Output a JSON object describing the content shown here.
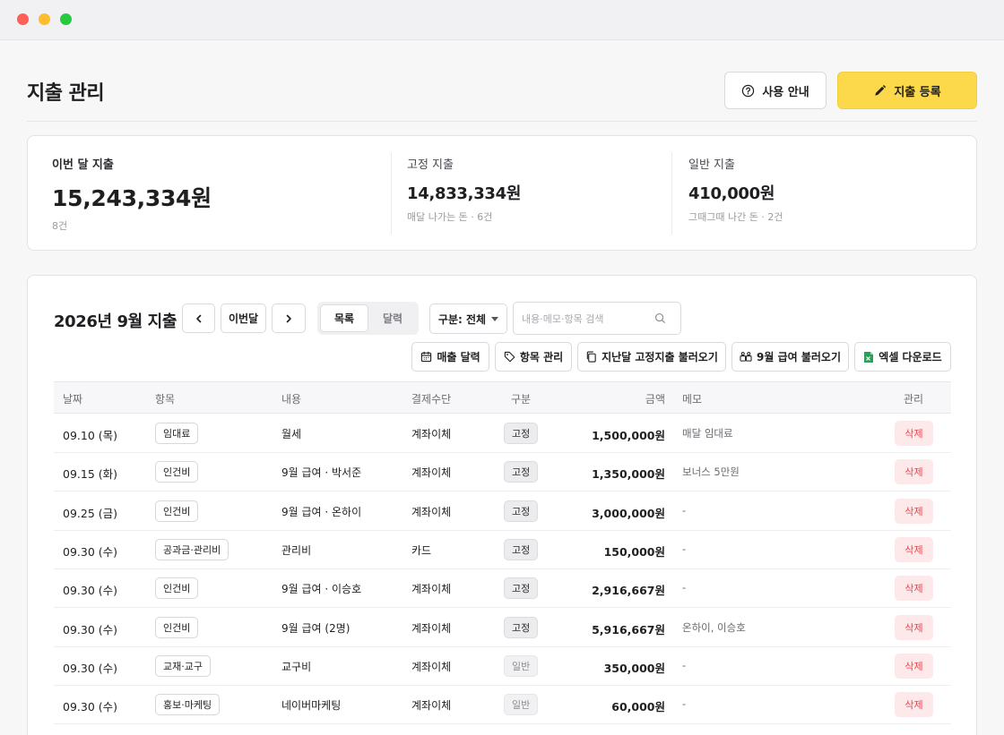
{
  "page": {
    "title": "지출 관리",
    "help_label": "사용 안내",
    "add_label": "지출 등록"
  },
  "summary": {
    "month": {
      "label": "이번 달 지출",
      "value": "15,243,334원",
      "sub": "8건"
    },
    "fixed": {
      "label": "고정 지출",
      "value": "14,833,334원",
      "sub": "매달 나가는 돈 · 6건"
    },
    "normal": {
      "label": "일반 지출",
      "value": "410,000원",
      "sub": "그때그때 나간 돈 · 2건"
    }
  },
  "toolbar": {
    "period_title": "2026년 9월 지출",
    "this_month": "이번달",
    "view_list": "목록",
    "view_calendar": "달력",
    "filter": "구분: 전체",
    "search_placeholder": "내용·메모·항목 검색",
    "sales_calendar": "매출 달력",
    "manage_items": "항목 관리",
    "load_fixed": "지난달 고정지출 불러오기",
    "load_salary": "9월 급여 불러오기",
    "excel": "엑셀 다운로드"
  },
  "table": {
    "columns": [
      "날짜",
      "항목",
      "내용",
      "결제수단",
      "구분",
      "금액",
      "메모",
      "관리"
    ],
    "delete_label": "삭제",
    "rows": [
      {
        "date": "09.10 (목)",
        "category": "임대료",
        "desc": "월세",
        "payment": "계좌이체",
        "type": "고정",
        "type_kind": "fixed",
        "amount": "1,500,000원",
        "memo": "매달 임대료"
      },
      {
        "date": "09.15 (화)",
        "category": "인건비",
        "desc": "9월 급여 · 박서준",
        "payment": "계좌이체",
        "type": "고정",
        "type_kind": "fixed",
        "amount": "1,350,000원",
        "memo": "보너스 5만원"
      },
      {
        "date": "09.25 (금)",
        "category": "인건비",
        "desc": "9월 급여 · 온하이",
        "payment": "계좌이체",
        "type": "고정",
        "type_kind": "fixed",
        "amount": "3,000,000원",
        "memo": "-"
      },
      {
        "date": "09.30 (수)",
        "category": "공과금·관리비",
        "desc": "관리비",
        "payment": "카드",
        "type": "고정",
        "type_kind": "fixed",
        "amount": "150,000원",
        "memo": "-"
      },
      {
        "date": "09.30 (수)",
        "category": "인건비",
        "desc": "9월 급여 · 이승호",
        "payment": "계좌이체",
        "type": "고정",
        "type_kind": "fixed",
        "amount": "2,916,667원",
        "memo": "-"
      },
      {
        "date": "09.30 (수)",
        "category": "인건비",
        "desc": "9월 급여 (2명)",
        "payment": "계좌이체",
        "type": "고정",
        "type_kind": "fixed",
        "amount": "5,916,667원",
        "memo": "온하이, 이승호"
      },
      {
        "date": "09.30 (수)",
        "category": "교재·교구",
        "desc": "교구비",
        "payment": "계좌이체",
        "type": "일반",
        "type_kind": "normal",
        "amount": "350,000원",
        "memo": "-"
      },
      {
        "date": "09.30 (수)",
        "category": "홍보·마케팅",
        "desc": "네이버마케팅",
        "payment": "계좌이체",
        "type": "일반",
        "type_kind": "normal",
        "amount": "60,000원",
        "memo": "-"
      }
    ]
  }
}
